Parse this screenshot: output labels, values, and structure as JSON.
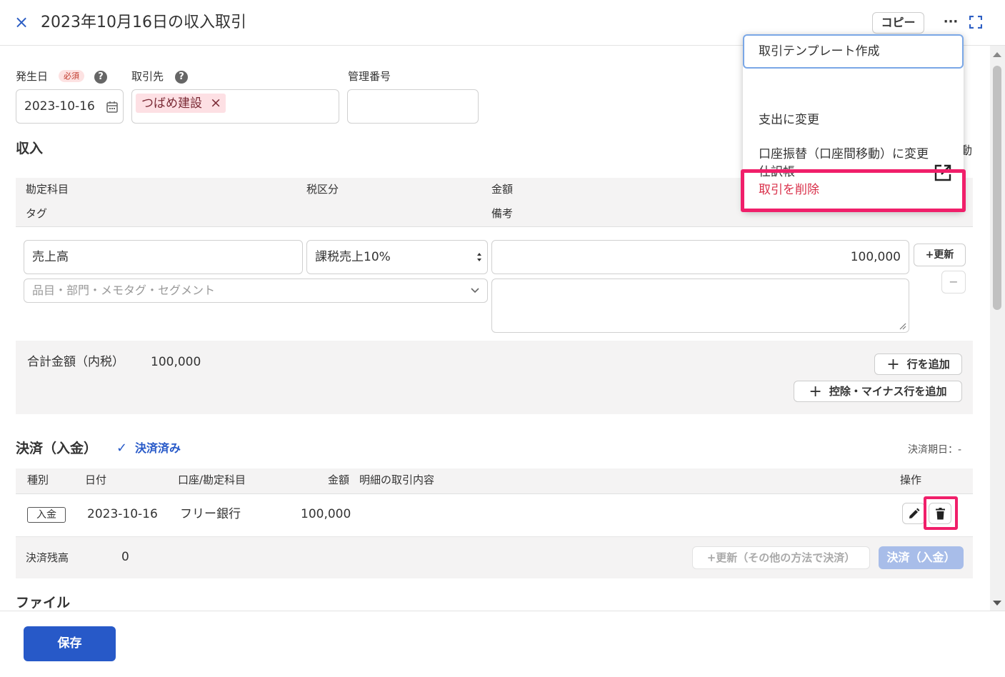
{
  "header": {
    "close_icon": "×",
    "title": "2023年10月16日の収入取引",
    "copy_label": "コピー",
    "more_icon": "···",
    "expand_icon": "expand-icon"
  },
  "form": {
    "date_label": "発生日",
    "required_badge": "必須",
    "help_icon": "?",
    "date_value": "2023-10-16",
    "partner_label": "取引先",
    "partner_tag": "つばめ建設",
    "partner_remove_icon": "×",
    "control_number_label": "管理番号",
    "control_number_value": ""
  },
  "income": {
    "section_title": "収入",
    "partial_text": "動",
    "headers": {
      "account": "勘定科目",
      "tax": "税区分",
      "amount": "金額",
      "tag": "タグ",
      "note": "備考"
    },
    "row": {
      "account": "売上高",
      "tax": "課税売上10%",
      "amount": "100,000",
      "tag_placeholder": "品目・部門・メモタグ・セグメント",
      "note": "",
      "update_label": "+更新",
      "remove_icon": "−"
    },
    "total_label": "合計金額（内税）",
    "total_value": "100,000",
    "add_row_label": "行を追加",
    "add_deduction_label": "控除・マイナス行を追加",
    "plus_icon": "+"
  },
  "settlement": {
    "title": "決済（入金）",
    "check_icon": "✓",
    "status": "決済済み",
    "due_date": "決済期日：-",
    "headers": {
      "type": "種別",
      "date": "日付",
      "account": "口座/勘定科目",
      "amount": "金額",
      "detail": "明細の取引内容",
      "ops": "操作"
    },
    "row": {
      "type": "入金",
      "date": "2023-10-16",
      "account": "フリー銀行",
      "amount": "100,000",
      "detail": ""
    },
    "balance_label": "決済残高",
    "balance_value": "0",
    "update_other_label": "+更新（その他の方法で決済）",
    "settle_label": "決済（入金）"
  },
  "files": {
    "title": "ファイル"
  },
  "menu": {
    "items": [
      "取引テンプレート作成",
      "支出に変更",
      "口座振替（口座間移動）に変更",
      "仕訳帳",
      "取引を削除"
    ]
  },
  "footer": {
    "save_label": "保存"
  },
  "colors": {
    "accent": "#2759c8",
    "highlight": "#f01f6a",
    "danger_text": "#d9304a",
    "tag_bg": "#fde0e4"
  }
}
